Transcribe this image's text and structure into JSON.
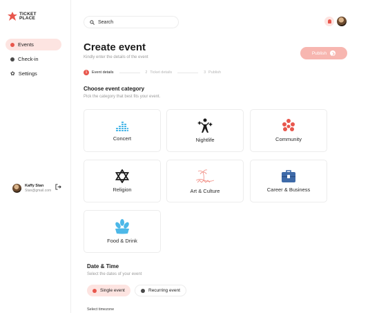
{
  "brand": {
    "line1": "TICKET",
    "line2": "PLACE"
  },
  "sidebar": {
    "items": [
      {
        "label": "Events",
        "icon": "events-dot-icon",
        "active": true
      },
      {
        "label": "Check-in",
        "icon": "check-in-dot-icon",
        "active": false
      },
      {
        "label": "Settings",
        "icon": "gear-icon",
        "active": false
      }
    ]
  },
  "profile": {
    "name": "Kaffy Stan",
    "email": "Stan@gmail.com"
  },
  "search": {
    "placeholder": "Search"
  },
  "header": {
    "title": "Create event",
    "subtitle": "Kindly enter the details of the event",
    "publish_label": "Publish"
  },
  "steps": [
    {
      "number": "1",
      "label": "Event details",
      "active": true
    },
    {
      "number": "2",
      "label": "Ticket details",
      "active": false
    },
    {
      "number": "3",
      "label": "Publish",
      "active": false
    }
  ],
  "category": {
    "title": "Choose event category",
    "subtitle": "Pick the category that best fits your event.",
    "cards": [
      {
        "label": "Concert",
        "icon": "equalizer-icon"
      },
      {
        "label": "Nightlife",
        "icon": "dancer-icon"
      },
      {
        "label": "Community",
        "icon": "community-icon"
      },
      {
        "label": "Religion",
        "icon": "star-of-david-icon"
      },
      {
        "label": "Art & Culture",
        "icon": "palm-tree-icon"
      },
      {
        "label": "Career & Business",
        "icon": "briefcase-icon"
      },
      {
        "label": "Food & Drink",
        "icon": "wheat-icon"
      }
    ]
  },
  "datetime": {
    "title": "Date & Time",
    "subtitle": "Select the dates of your event",
    "options": [
      {
        "label": "Single event",
        "selected": true
      },
      {
        "label": "Recurring event",
        "selected": false
      }
    ],
    "timezone_label": "Select timezone"
  },
  "colors": {
    "accent": "#e8574d",
    "accent_light": "#fde4e1",
    "publish_disabled": "#f7b6b0",
    "concert": "#4db8e8",
    "career": "#3e6aa8"
  }
}
